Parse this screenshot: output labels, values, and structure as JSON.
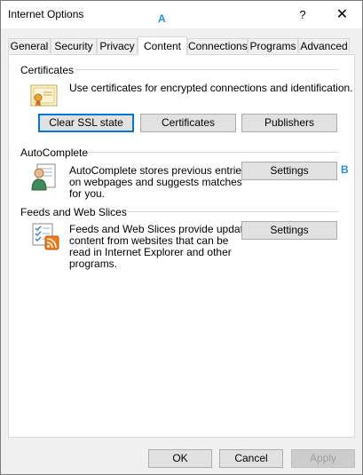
{
  "window": {
    "title": "Internet Options",
    "help_label": "?",
    "close_label": "✕"
  },
  "annotations": {
    "a": "A",
    "b": "B"
  },
  "tabs": [
    {
      "label": "General"
    },
    {
      "label": "Security"
    },
    {
      "label": "Privacy"
    },
    {
      "label": "Content",
      "active": true
    },
    {
      "label": "Connections"
    },
    {
      "label": "Programs"
    },
    {
      "label": "Advanced"
    }
  ],
  "certificates": {
    "heading": "Certificates",
    "description": "Use certificates for encrypted connections and identification.",
    "icon": "certificate-icon",
    "buttons": {
      "clear_ssl": "Clear SSL state",
      "certificates": "Certificates",
      "publishers": "Publishers"
    }
  },
  "autocomplete": {
    "heading": "AutoComplete",
    "description_lines": [
      "AutoComplete stores previous entries",
      "on webpages and suggests matches",
      "for you."
    ],
    "icon": "user-form-icon",
    "settings_label": "Settings"
  },
  "feeds": {
    "heading": "Feeds and Web Slices",
    "description_lines": [
      "Feeds and Web Slices provide updated",
      "content from websites that can be",
      "read in Internet Explorer and other",
      "programs."
    ],
    "icon": "rss-feed-icon",
    "settings_label": "Settings"
  },
  "footer": {
    "ok": "OK",
    "cancel": "Cancel",
    "apply": "Apply"
  },
  "colors": {
    "accent": "#0078d7",
    "annotation": "#2a8dd4"
  }
}
